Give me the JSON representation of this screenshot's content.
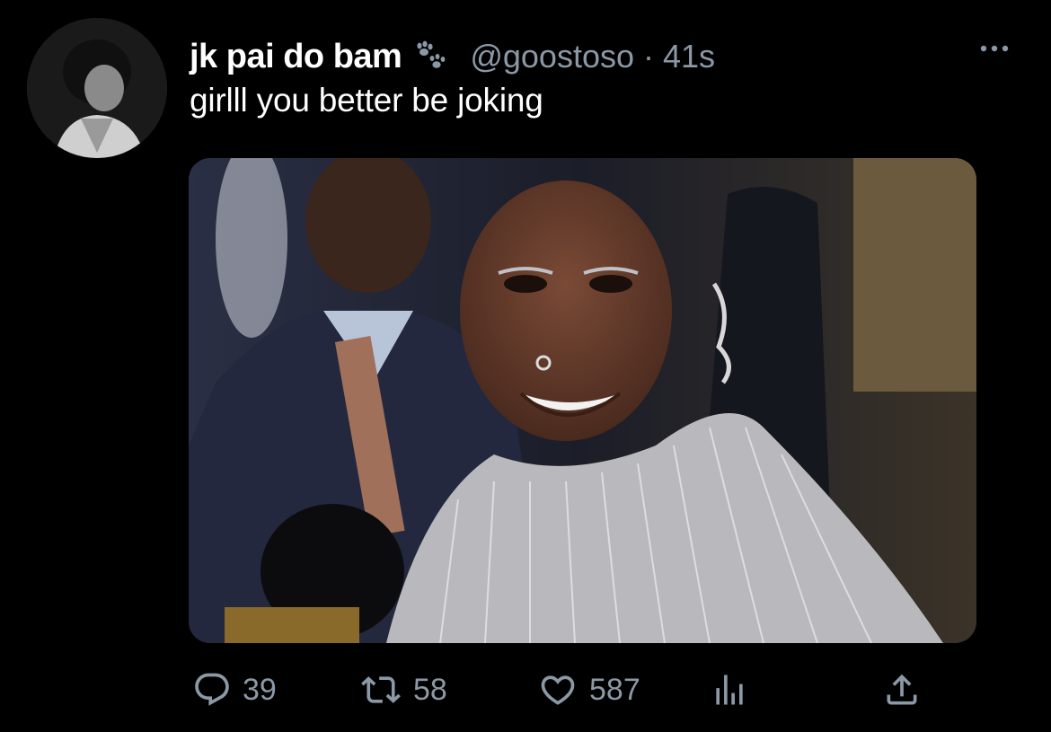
{
  "tweet": {
    "display_name": "jk pai do bam",
    "handle": "@goostoso",
    "separator": "·",
    "time": "41s",
    "text": "girlll you better be joking"
  },
  "icons": {
    "badge": "paw-prints-icon",
    "more": "more-horizontal-icon",
    "reply": "reply-icon",
    "retweet": "retweet-icon",
    "like": "heart-icon",
    "views": "analytics-icon",
    "share": "share-icon"
  },
  "actions": {
    "reply_count": "39",
    "retweet_count": "58",
    "like_count": "587"
  },
  "colors": {
    "background": "#000000",
    "primary_text": "#ffffff",
    "secondary_text": "#8b98a5"
  }
}
